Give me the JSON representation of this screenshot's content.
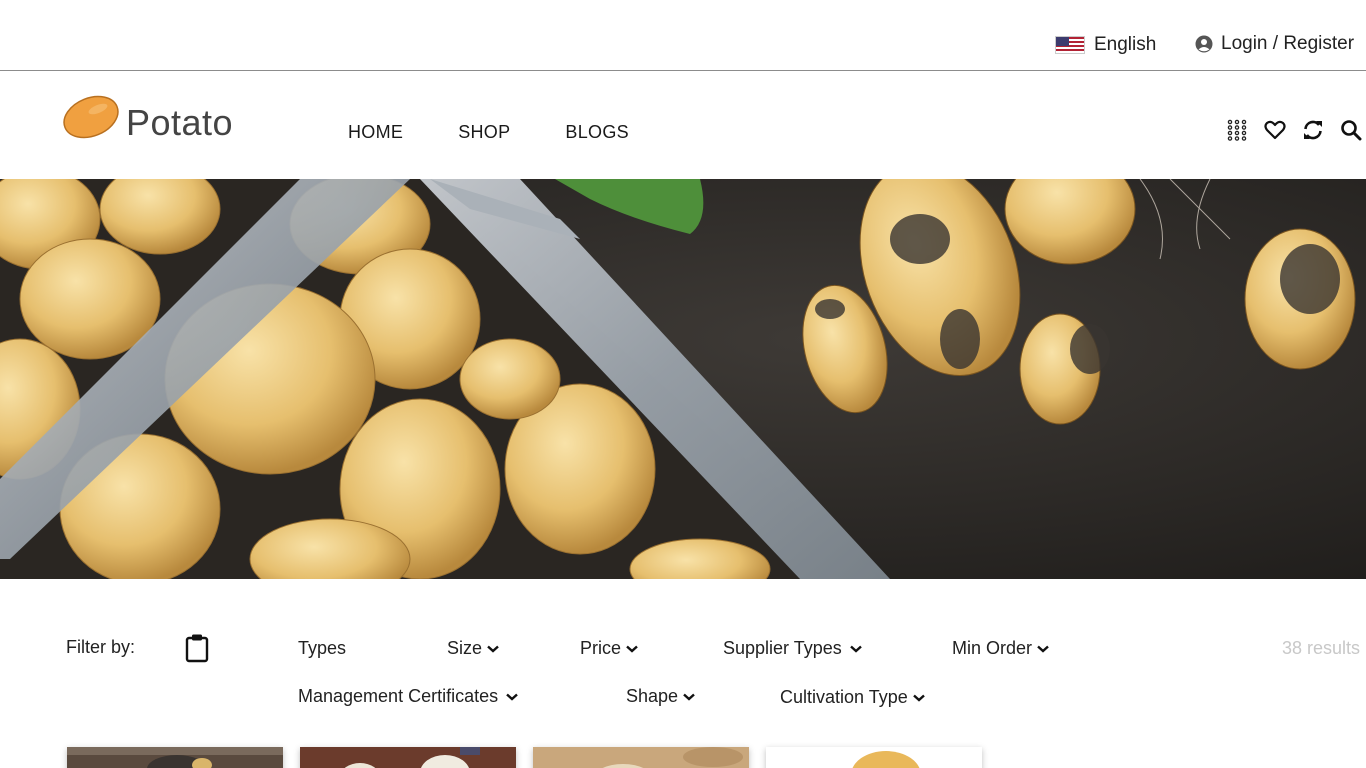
{
  "topbar": {
    "language": "English",
    "login": "Login / Register"
  },
  "header": {
    "logo_text": "Potato",
    "nav": [
      "HOME",
      "SHOP",
      "BLOGS"
    ],
    "icons": [
      "grid-icon",
      "heart-icon",
      "refresh-icon",
      "search-icon"
    ]
  },
  "filter": {
    "label": "Filter by:",
    "items": [
      "Types",
      "Size",
      "Price",
      "Supplier Types",
      "Min Order",
      "Management Certificates",
      "Shape",
      "Cultivation Type"
    ],
    "results": "38 results"
  },
  "colors": {
    "logo_orange": "#f0a040",
    "border": "#8c8c8c",
    "results_text": "#c8c8c8"
  }
}
